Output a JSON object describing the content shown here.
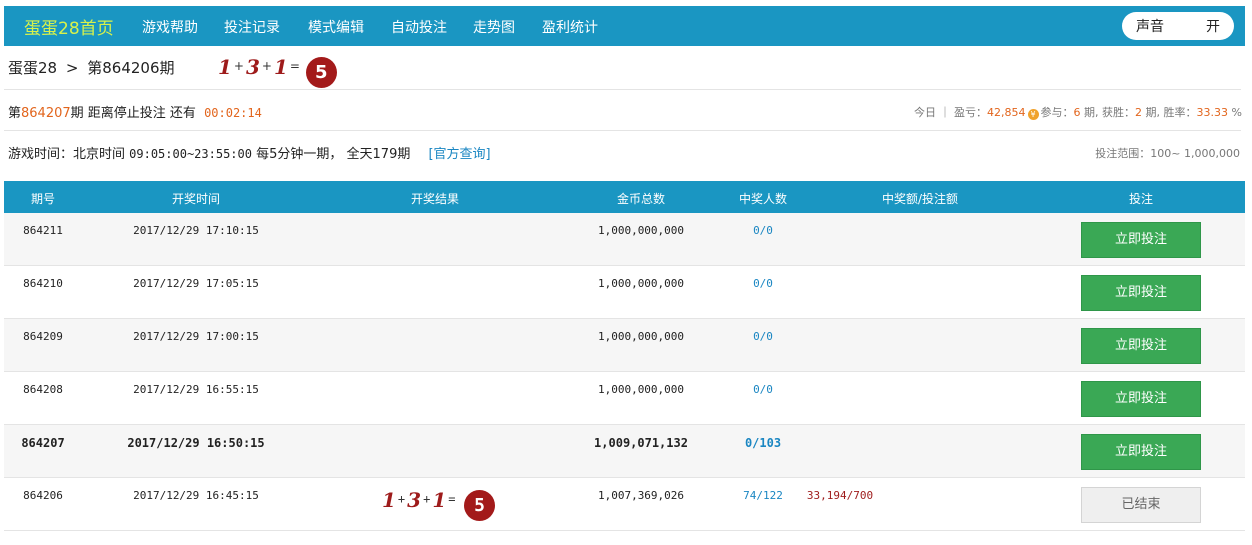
{
  "nav": {
    "home": "蛋蛋28首页",
    "items": [
      "游戏帮助",
      "投注记录",
      "模式编辑",
      "自动投注",
      "走势图",
      "盈利统计"
    ],
    "sound_label": "声音",
    "sound_value": "开"
  },
  "crumb": {
    "game": "蛋蛋28",
    "sep": ">",
    "period": "第864206期"
  },
  "header_result": {
    "a": "1",
    "b": "3",
    "c": "1",
    "sum": "5",
    "plus": "+",
    "eq": "="
  },
  "countdown": {
    "prefix": "第",
    "period": "864207",
    "suffix": "期 距离停止投注 还有",
    "time": "00:02:14"
  },
  "stats": {
    "today": "今日 ｜ 盈亏：",
    "profit": "42,854",
    "coin_icon": "coin-icon",
    "join_label": "参与：",
    "join": "6",
    "win_label": "期, 获胜：",
    "win": "2",
    "rate_label": "期, 胜率：",
    "rate": "33.33",
    "pct": "%"
  },
  "timeinfo": {
    "label": "游戏时间：北京时间",
    "hours": "09:05:00~23:55:00",
    "desc": "每5分钟一期，  全天179期",
    "link": "[官方查询]"
  },
  "range": "投注范围：100~ 1,000,000",
  "table": {
    "headers": [
      "期号",
      "开奖时间",
      "开奖结果",
      "金币总数",
      "中奖人数",
      "中奖额/投注额",
      "投注"
    ],
    "rows": [
      {
        "id": "864211",
        "time": "2017/12/29 17:10:15",
        "total": "1,000,000,000",
        "winners": "0/0",
        "ratio": "",
        "action": "立即投注"
      },
      {
        "id": "864210",
        "time": "2017/12/29 17:05:15",
        "total": "1,000,000,000",
        "winners": "0/0",
        "ratio": "",
        "action": "立即投注"
      },
      {
        "id": "864209",
        "time": "2017/12/29 17:00:15",
        "total": "1,000,000,000",
        "winners": "0/0",
        "ratio": "",
        "action": "立即投注"
      },
      {
        "id": "864208",
        "time": "2017/12/29 16:55:15",
        "total": "1,000,000,000",
        "winners": "0/0",
        "ratio": "",
        "action": "立即投注"
      },
      {
        "id": "864207",
        "time": "2017/12/29 16:50:15",
        "total": "1,009,071,132",
        "winners": "0/103",
        "ratio": "",
        "action": "立即投注"
      },
      {
        "id": "864206",
        "time": "2017/12/29 16:45:15",
        "total": "1,007,369,026",
        "winners": "74/122",
        "ratio": "33,194/700",
        "action": "已结束",
        "result": {
          "a": "1",
          "b": "3",
          "c": "1",
          "sum": "5"
        }
      }
    ]
  }
}
